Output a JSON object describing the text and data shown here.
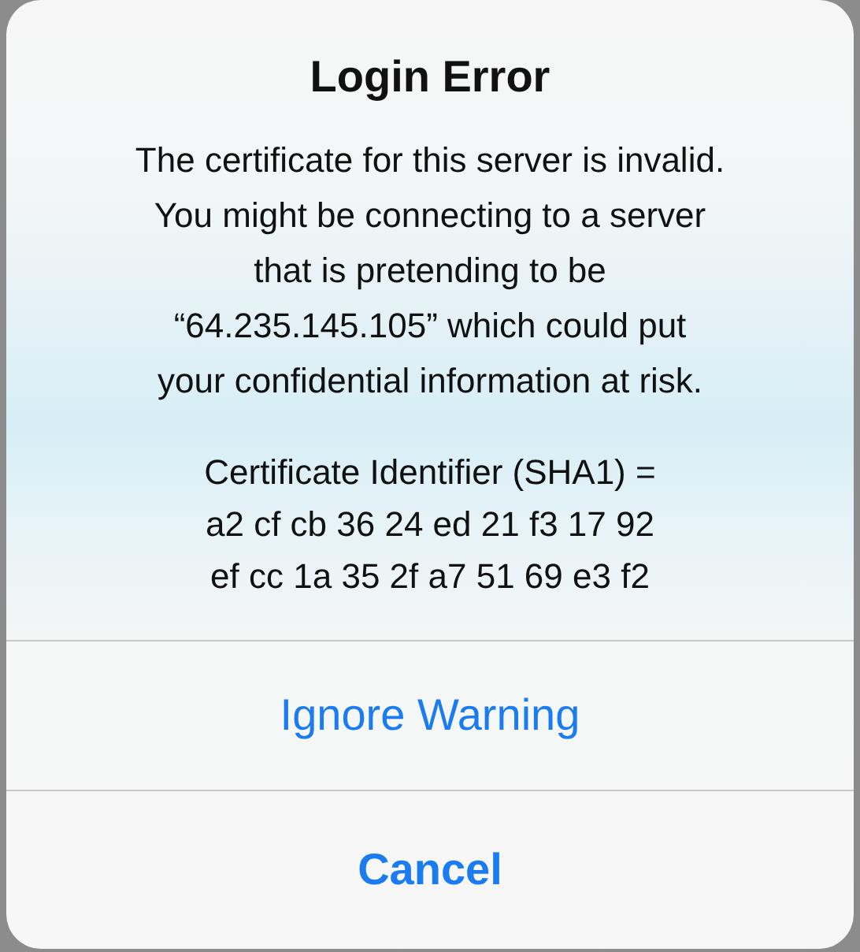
{
  "alert": {
    "title": "Login Error",
    "message": "The certificate for this server is invalid.\nYou might be connecting to a server\nthat is pretending to be\n“64.235.145.105” which could put\nyour confidential information at risk.",
    "details": "Certificate Identifier (SHA1) =\na2 cf cb 36 24 ed 21 f3 17 92\nef cc 1a 35 2f a7 51 69 e3 f2",
    "buttons": [
      {
        "label": "Ignore Warning",
        "kind": "default"
      },
      {
        "label": "Cancel",
        "kind": "cancel"
      }
    ]
  }
}
